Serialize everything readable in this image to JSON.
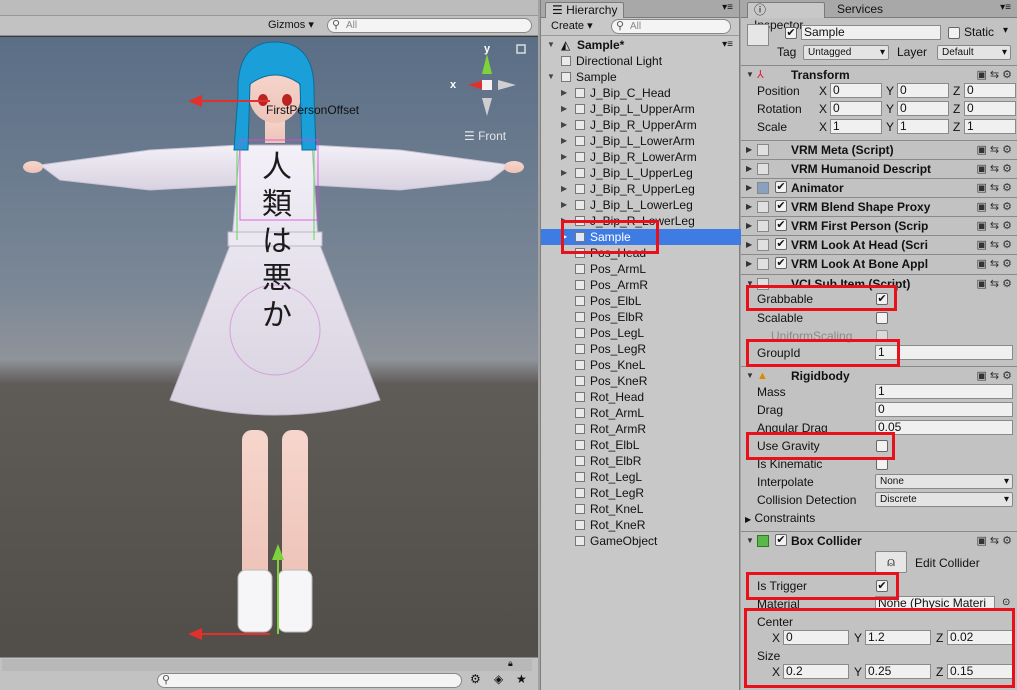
{
  "scene": {
    "gizmos_label": "Gizmos",
    "search_placeholder": "All",
    "label_first_person": "FirstPersonOffset",
    "view_label": "Front",
    "axis_y": "y",
    "axis_x": "x",
    "shirt_text": "人類は悪か",
    "bottom_search_placeholder": ""
  },
  "hierarchy": {
    "tab_label": "Hierarchy",
    "create_label": "Create",
    "search_placeholder": "All",
    "scene_name": "Sample*",
    "items": [
      {
        "label": "Directional Light"
      },
      {
        "label": "Sample"
      },
      {
        "label": "J_Bip_C_Head"
      },
      {
        "label": "J_Bip_L_UpperArm"
      },
      {
        "label": "J_Bip_R_UpperArm"
      },
      {
        "label": "J_Bip_L_LowerArm"
      },
      {
        "label": "J_Bip_R_LowerArm"
      },
      {
        "label": "J_Bip_L_UpperLeg"
      },
      {
        "label": "J_Bip_R_UpperLeg"
      },
      {
        "label": "J_Bip_L_LowerLeg"
      },
      {
        "label": "J_Bip_R_LowerLeg"
      },
      {
        "label": "Sample"
      },
      {
        "label": "Pos_Head"
      },
      {
        "label": "Pos_ArmL"
      },
      {
        "label": "Pos_ArmR"
      },
      {
        "label": "Pos_ElbL"
      },
      {
        "label": "Pos_ElbR"
      },
      {
        "label": "Pos_LegL"
      },
      {
        "label": "Pos_LegR"
      },
      {
        "label": "Pos_KneL"
      },
      {
        "label": "Pos_KneR"
      },
      {
        "label": "Rot_Head"
      },
      {
        "label": "Rot_ArmL"
      },
      {
        "label": "Rot_ArmR"
      },
      {
        "label": "Rot_ElbL"
      },
      {
        "label": "Rot_ElbR"
      },
      {
        "label": "Rot_LegL"
      },
      {
        "label": "Rot_LegR"
      },
      {
        "label": "Rot_KneL"
      },
      {
        "label": "Rot_KneR"
      },
      {
        "label": "GameObject"
      }
    ]
  },
  "inspector": {
    "tab_inspector": "Inspector",
    "tab_services": "Services",
    "object_name": "Sample",
    "static_label": "Static",
    "tag_label": "Tag",
    "tag_value": "Untagged",
    "layer_label": "Layer",
    "layer_value": "Default",
    "transform": {
      "title": "Transform",
      "position_label": "Position",
      "rotation_label": "Rotation",
      "scale_label": "Scale",
      "x": "X",
      "y": "Y",
      "z": "Z",
      "position": [
        "0",
        "0",
        "0"
      ],
      "rotation": [
        "0",
        "0",
        "0"
      ],
      "scale": [
        "1",
        "1",
        "1"
      ]
    },
    "components": [
      {
        "title": "VRM Meta (Script)"
      },
      {
        "title": "VRM Humanoid Descript"
      },
      {
        "title": "Animator"
      },
      {
        "title": "VRM Blend Shape Proxy"
      },
      {
        "title": "VRM First Person (Scrip"
      },
      {
        "title": "VRM Look At Head (Scri"
      },
      {
        "title": "VRM Look At Bone Appl"
      }
    ],
    "vci_sub_item": {
      "title": "VCI Sub Item (Script)",
      "grabbable_label": "Grabbable",
      "grabbable": "✔",
      "scalable_label": "Scalable",
      "uniform_scaling_label": "UniformScaling",
      "group_id_label": "GroupId",
      "group_id": "1"
    },
    "rigidbody": {
      "title": "Rigidbody",
      "mass_label": "Mass",
      "mass": "1",
      "drag_label": "Drag",
      "drag": "0",
      "angular_drag_label": "Angular Drag",
      "angular_drag": "0.05",
      "use_gravity_label": "Use Gravity",
      "is_kinematic_label": "Is Kinematic",
      "interpolate_label": "Interpolate",
      "interpolate": "None",
      "collision_label": "Collision Detection",
      "collision": "Discrete",
      "constraints_label": "Constraints"
    },
    "box_collider": {
      "title": "Box Collider",
      "edit_collider_label": "Edit Collider",
      "is_trigger_label": "Is Trigger",
      "is_trigger": "✔",
      "material_label": "Material",
      "material": "None (Physic Materi",
      "center_label": "Center",
      "size_label": "Size",
      "x": "X",
      "y": "Y",
      "z": "Z",
      "center": [
        "0",
        "1.2",
        "0.02"
      ],
      "size": [
        "0.2",
        "0.25",
        "0.15"
      ]
    }
  },
  "colors": {
    "selection": "#3e7ce4",
    "highlight": "#e8101a",
    "axis_x": "#e2302c",
    "axis_y": "#7fd33a"
  }
}
